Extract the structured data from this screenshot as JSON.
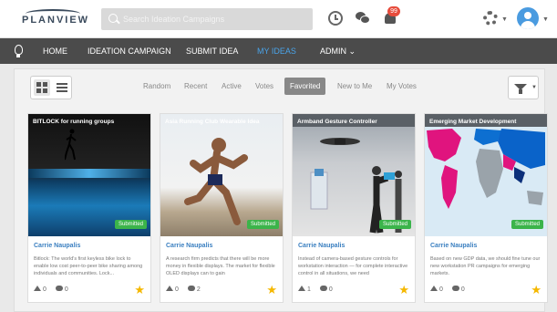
{
  "header": {
    "logo_text": "PLANVIEW",
    "search_placeholder": "Search Ideation Campaigns",
    "notification_count": "99"
  },
  "nav": {
    "items": [
      {
        "label": "HOME"
      },
      {
        "label": "IDEATION CAMPAIGN"
      },
      {
        "label": "SUBMIT IDEA"
      },
      {
        "label": "MY IDEAS"
      },
      {
        "label": "ADMIN ⌄"
      }
    ]
  },
  "filters": {
    "tabs": [
      {
        "label": "Random"
      },
      {
        "label": "Recent"
      },
      {
        "label": "Active"
      },
      {
        "label": "Votes"
      },
      {
        "label": "Favorited"
      },
      {
        "label": "New to Me"
      },
      {
        "label": "My Votes"
      }
    ]
  },
  "cards": [
    {
      "title": "BITLOCK for running groups",
      "status": "Submitted",
      "author": "Carrie Naupalis",
      "description": "Bitlock: The world's first keyless bike lock to enable low cost peer-to-peer bike sharing among individuals and communities. Lock...",
      "votes": "0",
      "comments": "0"
    },
    {
      "title": "Asia Running Club Wearable Idea",
      "status": "Submitted",
      "author": "Carrie Naupalis",
      "description": "A research firm predicts that there will be more money in flexible displays. The market for flexible OLED displays can to gain",
      "votes": "0",
      "comments": "2"
    },
    {
      "title": "Armband Gesture Controller",
      "status": "Submitted",
      "author": "Carrie Naupalis",
      "description": "Instead of camera-based gesture controls for workstation interaction — for complete interactive control in all situations, we need",
      "votes": "1",
      "comments": "0"
    },
    {
      "title": "Emerging Market Development",
      "status": "Submitted",
      "author": "Carrie Naupalis",
      "description": "Based on new GDP data, we should fine tune our new workstation PR campaigns for emerging markets.",
      "votes": "0",
      "comments": "0"
    }
  ],
  "colors": {
    "nav_bg": "#4b4b4b",
    "accent": "#4aa3e8",
    "submitted": "#3bb44a",
    "star": "#f5b800"
  }
}
